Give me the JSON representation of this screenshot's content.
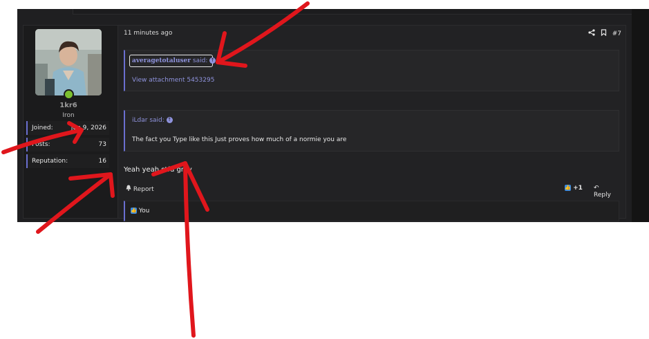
{
  "post": {
    "time": "11 minutes ago",
    "number": "#7",
    "user": {
      "name": "1kr6",
      "title": "Iron",
      "stats": [
        {
          "label": "Joined:",
          "value": "Jun 9, 2026"
        },
        {
          "label": "Posts:",
          "value": "73"
        },
        {
          "label": "Reputation:",
          "value": "16"
        }
      ]
    },
    "quotes": [
      {
        "author": "averagetotaluser",
        "said": "said:",
        "body": "View attachment 5453295"
      },
      {
        "author": "iLdar",
        "said": "said:",
        "body": "The fact you Type like this Just proves how much of a normie you are"
      }
    ],
    "message": "Yeah yeah stfu grey",
    "footer": {
      "report": "Report",
      "like_count": "+1",
      "reply": "Reply"
    },
    "reactions": {
      "text": "You"
    }
  },
  "colors": {
    "accent": "#6a6fd0",
    "link": "#8f93dd",
    "online": "#7cc030",
    "annotation": "#e0161c"
  },
  "icons": [
    "share-icon",
    "bookmark-icon",
    "quote-arrow-icon",
    "bell-icon",
    "thumbs-up-icon",
    "reply-icon"
  ]
}
